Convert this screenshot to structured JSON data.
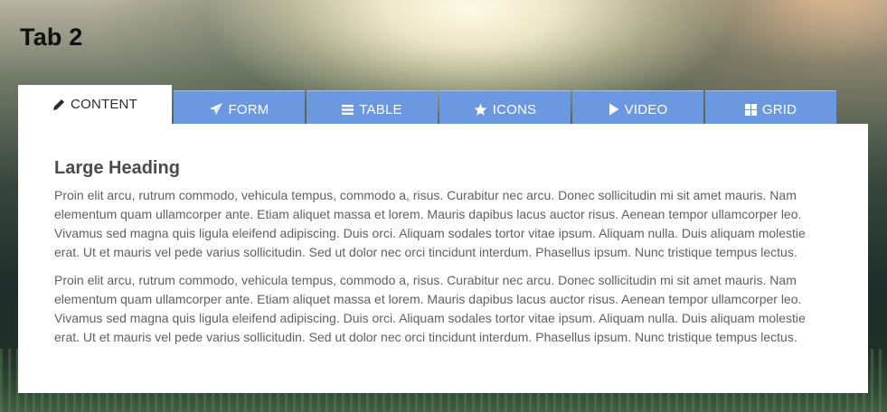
{
  "page": {
    "title": "Tab 2"
  },
  "tabs": [
    {
      "label": "CONTENT",
      "icon": "pencil-icon",
      "active": true
    },
    {
      "label": "FORM",
      "icon": "paper-plane-icon",
      "active": false
    },
    {
      "label": "TABLE",
      "icon": "list-icon",
      "active": false
    },
    {
      "label": "ICONS",
      "icon": "star-icon",
      "active": false
    },
    {
      "label": "VIDEO",
      "icon": "play-icon",
      "active": false
    },
    {
      "label": "GRID",
      "icon": "grid-icon",
      "active": false
    }
  ],
  "content": {
    "heading": "Large Heading",
    "paragraphs": [
      "Proin elit arcu, rutrum commodo, vehicula tempus, commodo a, risus. Curabitur nec arcu. Donec sollicitudin mi sit amet mauris. Nam elementum quam ullamcorper ante. Etiam aliquet massa et lorem. Mauris dapibus lacus auctor risus. Aenean tempor ullamcorper leo. Vivamus sed magna quis ligula eleifend adipiscing. Duis orci. Aliquam sodales tortor vitae ipsum. Aliquam nulla. Duis aliquam molestie erat. Ut et mauris vel pede varius sollicitudin. Sed ut dolor nec orci tincidunt interdum. Phasellus ipsum. Nunc tristique tempus lectus.",
      "Proin elit arcu, rutrum commodo, vehicula tempus, commodo a, risus. Curabitur nec arcu. Donec sollicitudin mi sit amet mauris. Nam elementum quam ullamcorper ante. Etiam aliquet massa et lorem. Mauris dapibus lacus auctor risus. Aenean tempor ullamcorper leo. Vivamus sed magna quis ligula eleifend adipiscing. Duis orci. Aliquam sodales tortor vitae ipsum. Aliquam nulla. Duis aliquam molestie erat. Ut et mauris vel pede varius sollicitudin. Sed ut dolor nec orci tincidunt interdum. Phasellus ipsum. Nunc tristique tempus lectus."
    ]
  },
  "colors": {
    "tab_inactive": "#6c98e2",
    "tab_active": "#ffffff",
    "heading": "#4b4b4b",
    "body_text": "#5f5f5f",
    "title": "#111111"
  }
}
